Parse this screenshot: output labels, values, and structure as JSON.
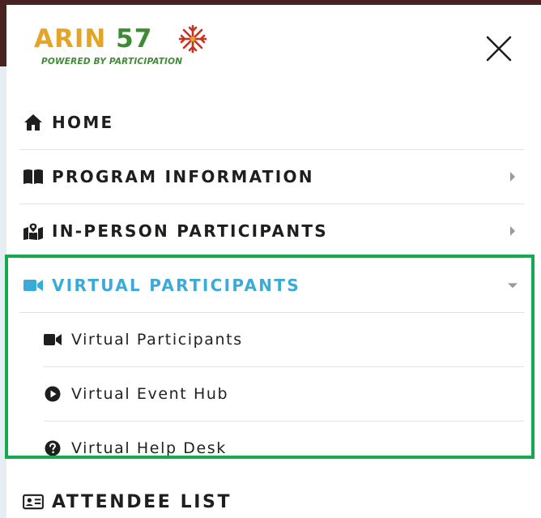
{
  "brand": {
    "name_word": "ARIN",
    "name_num": "57",
    "tagline": "POWERED BY PARTICIPATION",
    "colors": {
      "gold": "#e2a527",
      "green": "#3f8b35",
      "red": "#c8321f"
    }
  },
  "header": {
    "close_icon": "close-x-icon"
  },
  "menu": {
    "home": {
      "label": "HOME",
      "icon": "home-icon"
    },
    "program": {
      "label": "PROGRAM INFORMATION",
      "icon": "book-open-icon",
      "caret": "caret-right-icon"
    },
    "inperson": {
      "label": "IN-PERSON PARTICIPANTS",
      "icon": "map-marked-icon",
      "caret": "caret-right-icon"
    },
    "virtual": {
      "label": "VIRTUAL PARTICIPANTS",
      "icon": "video-camera-icon",
      "caret": "caret-down-icon",
      "expanded": true,
      "accent": "#3aaad9",
      "subitems": [
        {
          "label": "Virtual Participants",
          "icon": "video-camera-icon"
        },
        {
          "label": "Virtual Event Hub",
          "icon": "play-circle-icon"
        },
        {
          "label": "Virtual Help Desk",
          "icon": "question-circle-icon"
        }
      ]
    },
    "attendee": {
      "label": "ATTENDEE LIST",
      "icon": "id-card-icon"
    }
  },
  "highlight_color": "#16a94f"
}
